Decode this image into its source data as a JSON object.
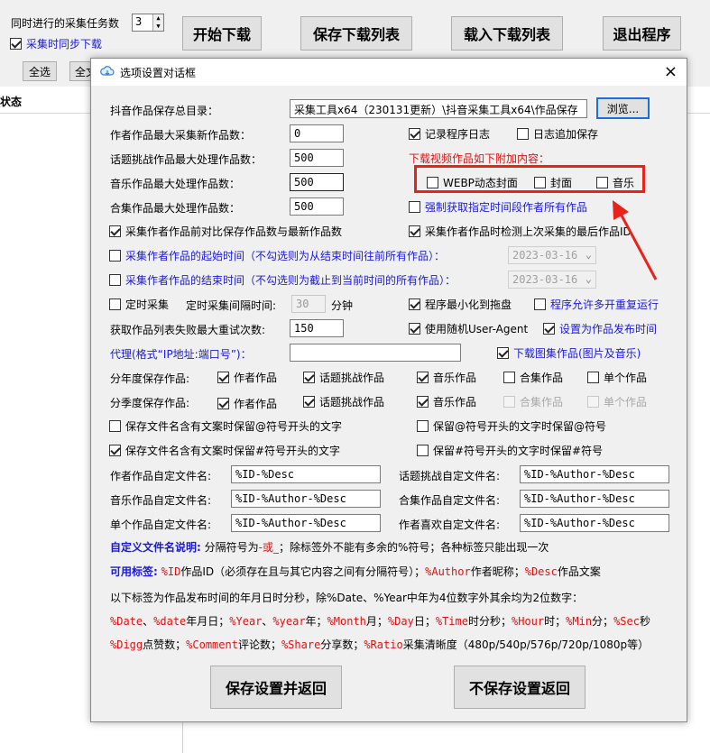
{
  "main": {
    "task_count_label": "同时进行的采集任务数",
    "task_count_value": "3",
    "sync_download_label": "采集时同步下载",
    "start_download": "开始下载",
    "save_list": "保存下载列表",
    "load_list": "载入下载列表",
    "exit": "退出程序",
    "select_all": "全选",
    "select_all_2": "全文",
    "status_header": "状态"
  },
  "dialog": {
    "title": "选项设置对话框",
    "close": "×",
    "save_dir_label": "抖音作品保存总目录：",
    "save_dir_value": "采集工具x64（230131更新）\\抖音采集工具x64\\作品保存",
    "browse": "浏览...",
    "author_max_label": "作者作品最大采集新作品数：",
    "author_max_value": "0",
    "topic_max_label": "话题挑战作品最大处理作品数：",
    "topic_max_value": "500",
    "music_max_label": "音乐作品最大处理作品数：",
    "music_max_value": "500",
    "collection_max_label": "合集作品最大处理作品数：",
    "collection_max_value": "500",
    "record_log": "记录程序日志",
    "log_append": "日志追加保存",
    "attach_title": "下载视频作品如下附加内容：",
    "webp_cover": "WEBP动态封面",
    "cover": "封面",
    "music": "音乐",
    "force_fetch": "强制获取指定时间段作者所有作品",
    "compare_count": "采集作者作品前对比保存作品数与最新作品数",
    "check_last_id": "采集作者作品时检测上次采集的最后作品ID",
    "start_time_label": "采集作者作品的起始时间（不勾选则为从结束时间往前所有作品）：",
    "start_date": "2023-03-16",
    "end_time_label": "采集作者作品的结束时间（不勾选则为截止到当前时间的所有作品）：",
    "end_date": "2023-03-16",
    "timed_collect": "定时采集",
    "interval_label": "定时采集间隔时间:",
    "interval_value": "30",
    "minutes": "分钟",
    "minimize_tray": "程序最小化到拖盘",
    "allow_multi": "程序允许多开重复运行",
    "retry_label": "获取作品列表失败最大重试次数:",
    "retry_value": "150",
    "random_ua": "使用随机User-Agent",
    "set_publish_time": "设置为作品发布时间",
    "proxy_label": "代理(格式“IP地址:端口号”)：",
    "proxy_value": "",
    "download_image_works": "下载图集作品(图片及音乐)",
    "by_year_label": "分年度保存作品:",
    "by_quarter_label": "分季度保存作品:",
    "cat_author": "作者作品",
    "cat_topic": "话题挑战作品",
    "cat_music": "音乐作品",
    "cat_collection": "合集作品",
    "cat_single": "单个作品",
    "keep_at_text": "保存文件名含有文案时保留@符号开头的文字",
    "keep_at_symbol": "保留@符号开头的文字时保留@符号",
    "keep_hash_text": "保存文件名含有文案时保留#符号开头的文字",
    "keep_hash_symbol": "保留#符号开头的文字时保留#符号",
    "author_filename_label": "作者作品自定文件名:",
    "author_filename_value": "%ID-%Desc",
    "topic_filename_label": "话题挑战自定文件名:",
    "topic_filename_value": "%ID-%Author-%Desc",
    "music_filename_label": "音乐作品自定文件名:",
    "music_filename_value": "%ID-%Author-%Desc",
    "collection_filename_label": "合集作品自定文件名:",
    "collection_filename_value": "%ID-%Author-%Desc",
    "single_filename_label": "单个作品自定文件名:",
    "single_filename_value": "%ID-%Author-%Desc",
    "liked_filename_label": "作者喜欢自定文件名:",
    "liked_filename_value": "%ID-%Author-%Desc",
    "note1_title": "自定义文件名说明:",
    "note1_a": "分隔符号为",
    "note1_b": "-或_",
    "note1_c": "；除标签外不能有多余的%符号；各种标签只能出现一次",
    "note2_title": "可用标签:",
    "note2_t1": "%ID",
    "note2_d1": "作品ID（必须存在且与其它内容之间有分隔符号）；",
    "note2_t2": "%Author",
    "note2_d2": "作者昵称；",
    "note2_t3": "%Desc",
    "note2_d3": "作品文案",
    "note3": "以下标签为作品发布时间的年月日时分秒，除%Date、%Year中年为4位数字外其余均为2位数字：",
    "n4_t1": "%Date",
    "n4_s1": "、",
    "n4_t2": "%date",
    "n4_d1": "年月日；",
    "n4_t3": "%Year",
    "n4_s2": "、",
    "n4_t4": "%year",
    "n4_d2": "年；",
    "n4_t5": "%Month",
    "n4_d3": "月；",
    "n4_t6": "%Day",
    "n4_d4": "日；",
    "n4_t7": "%Time",
    "n4_d5": "时分秒；",
    "n4_t8": "%Hour",
    "n4_d6": "时；",
    "n4_t9": "%Min",
    "n4_d7": "分；",
    "n4_t10": "%Sec",
    "n4_d8": "秒",
    "n5_t1": "%Digg",
    "n5_d1": "点赞数；",
    "n5_t2": "%Comment",
    "n5_d2": "评论数；",
    "n5_t3": "%Share",
    "n5_d3": "分享数；",
    "n5_t4": "%Ratio",
    "n5_d4": "采集清晰度（480p/540p/576p/720p/1080p等）",
    "save_return": "保存设置并返回",
    "nosave_return": "不保存设置返回"
  },
  "colors": {
    "accent_blue": "#1a1ad6",
    "tag_red": "#e01010",
    "annotation_red": "#e8231c"
  }
}
